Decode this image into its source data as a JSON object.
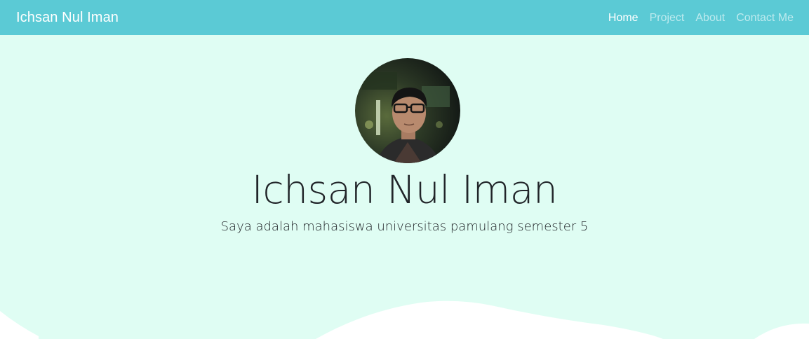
{
  "navbar": {
    "brand": "Ichsan Nul Iman",
    "items": [
      {
        "label": "Home",
        "active": true
      },
      {
        "label": "Project",
        "active": false
      },
      {
        "label": "About",
        "active": false
      },
      {
        "label": "Contact Me",
        "active": false
      }
    ]
  },
  "hero": {
    "title": "Ichsan Nul Iman",
    "lead": "Saya adalah mahasiswa universitas pamulang semester 5"
  },
  "colors": {
    "navbar": "#5bcad5",
    "background": "#dffdf3",
    "wave": "#ffffff"
  }
}
